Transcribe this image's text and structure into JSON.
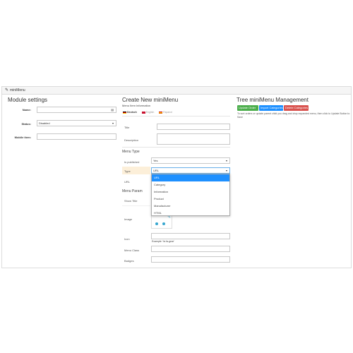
{
  "panel": {
    "title": "miniMenu"
  },
  "module": {
    "heading": "Module settings",
    "name_label": "Name:",
    "status_label": "Status:",
    "status_value": "Disabled",
    "mobile_label": "Mobile item:"
  },
  "create": {
    "heading": "Create New miniMenu",
    "subheading": "Menu Item Information",
    "tabs": [
      "Deutsch",
      "English",
      "Espanol"
    ],
    "title_label": "Title",
    "description_label": "Description",
    "menu_type_heading": "Menu Type",
    "published_label": "Is published",
    "published_value": "Yes",
    "type_label": "Type",
    "type_value": "URL",
    "url_label": "URL",
    "menu_param_heading": "Menu Param",
    "show_title_label": "Show Title",
    "image_label": "Image",
    "icon_label": "Icon",
    "icon_example": "Example: 'fa fa-gear'",
    "menu_class_label": "Menu Class",
    "badges_label": "Badges",
    "type_options": [
      "URL",
      "Category",
      "Information",
      "Product",
      "Manufacturer",
      "HTML"
    ]
  },
  "tree": {
    "heading": "Tree miniMenu Management",
    "buttons": [
      "Update Order",
      "Import Categories",
      "Delete Categories"
    ],
    "button_colors": [
      "#4cae4c",
      "#1e90ff",
      "#d9534f"
    ],
    "note": "To sort orders or update parent child you drag and drop expanded menu, then click to Update Button to Save"
  }
}
